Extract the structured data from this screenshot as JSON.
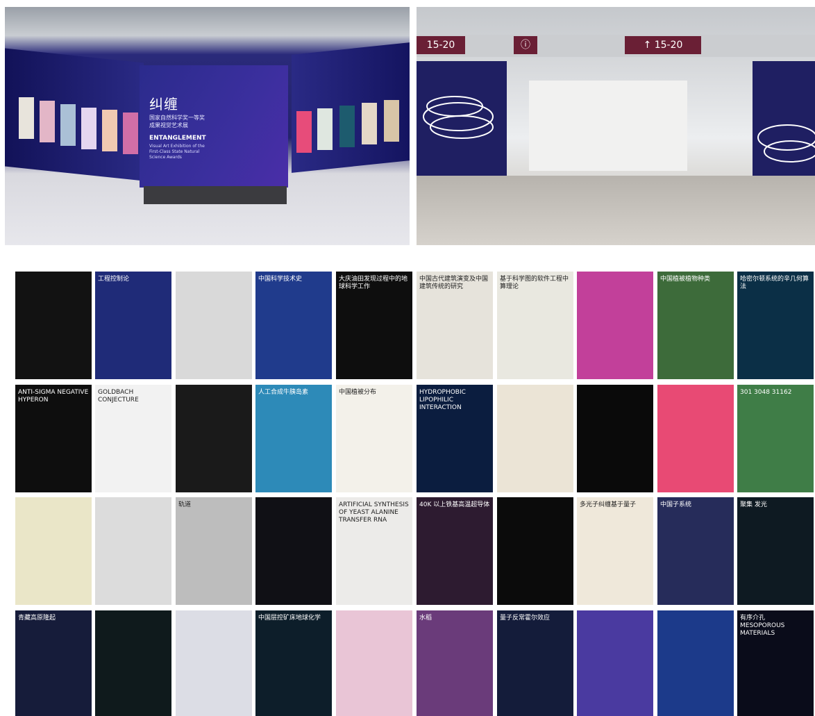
{
  "photo_left": {
    "booth_title": "纠缠",
    "booth_subtitle": "国家自然科学奖一等奖成果视觉艺术展",
    "booth_title_en": "ENTANGLEMENT",
    "booth_subtitle_en": "Visual Art Exhibition of the First-Class State Natural Science Awards"
  },
  "photo_right": {
    "sign_left": "15-20",
    "sign_info": "ⓘ",
    "sign_right": "↑ 15-20"
  },
  "posters": [
    {
      "text": "",
      "bg": "#121212"
    },
    {
      "text": "工程控制论",
      "bg": "#1f2b78"
    },
    {
      "text": "",
      "bg": "#d9d9d9"
    },
    {
      "text": "中国科学技术史",
      "bg": "#203b8c"
    },
    {
      "text": "大庆油田发现过程中的地球科学工作",
      "bg": "#0e0e0e"
    },
    {
      "text": "中国古代建筑演变及中国建筑传统的研究",
      "bg": "#e6e3db"
    },
    {
      "text": "基于科学图的软件工程中算理论",
      "bg": "#e9e8e0"
    },
    {
      "text": "",
      "bg": "#c2409a"
    },
    {
      "text": "中国植被植物种类",
      "bg": "#3d6b3a"
    },
    {
      "text": "哈密尔顿系统的辛几何算法",
      "bg": "#0b2f46"
    },
    {
      "text": "ANTI-SIGMA NEGATIVE HYPERON",
      "bg": "#0e0e0e"
    },
    {
      "text": "GOLDBACH CONJECTURE",
      "bg": "#f2f2f2"
    },
    {
      "text": "",
      "bg": "#1a1a1a"
    },
    {
      "text": "人工合成牛胰岛素",
      "bg": "#2d8ab8"
    },
    {
      "text": "中国植被分布",
      "bg": "#f3f1ea"
    },
    {
      "text": "HYDROPHOBIC LIPOPHILIC INTERACTION",
      "bg": "#0b1d3f"
    },
    {
      "text": "",
      "bg": "#ebe4d6"
    },
    {
      "text": "",
      "bg": "#0a0a0a"
    },
    {
      "text": "",
      "bg": "#e84a74"
    },
    {
      "text": "301 3048 31162",
      "bg": "#3f7d47"
    },
    {
      "text": "",
      "bg": "#eae6c8"
    },
    {
      "text": "",
      "bg": "#dcdcdc"
    },
    {
      "text": "轨道",
      "bg": "#bdbdbd"
    },
    {
      "text": "",
      "bg": "#101015"
    },
    {
      "text": "ARTIFICIAL SYNTHESIS OF YEAST ALANINE TRANSFER RNA",
      "bg": "#ecebe9"
    },
    {
      "text": "40K 以上铁基高温超导体",
      "bg": "#2d1b30"
    },
    {
      "text": "",
      "bg": "#0b0b0b"
    },
    {
      "text": "多光子纠缠基于量子",
      "bg": "#efe8da"
    },
    {
      "text": "中国子系统",
      "bg": "#262c5a"
    },
    {
      "text": "聚集 发光",
      "bg": "#0e1a22"
    },
    {
      "text": "青藏高原隆起",
      "bg": "#161c3a"
    },
    {
      "text": "",
      "bg": "#0f1a1c"
    },
    {
      "text": "",
      "bg": "#dcdde5"
    },
    {
      "text": "中国层控矿床地球化学",
      "bg": "#0d1e2a"
    },
    {
      "text": "",
      "bg": "#e9c5d6"
    },
    {
      "text": "水稻",
      "bg": "#6a3b7a"
    },
    {
      "text": "量子反常霍尔效应",
      "bg": "#141c3a"
    },
    {
      "text": "",
      "bg": "#4a3aa0"
    },
    {
      "text": "",
      "bg": "#1c3a8a"
    },
    {
      "text": "有序介孔 MESOPOROUS MATERIALS",
      "bg": "#0a0c1a"
    }
  ]
}
